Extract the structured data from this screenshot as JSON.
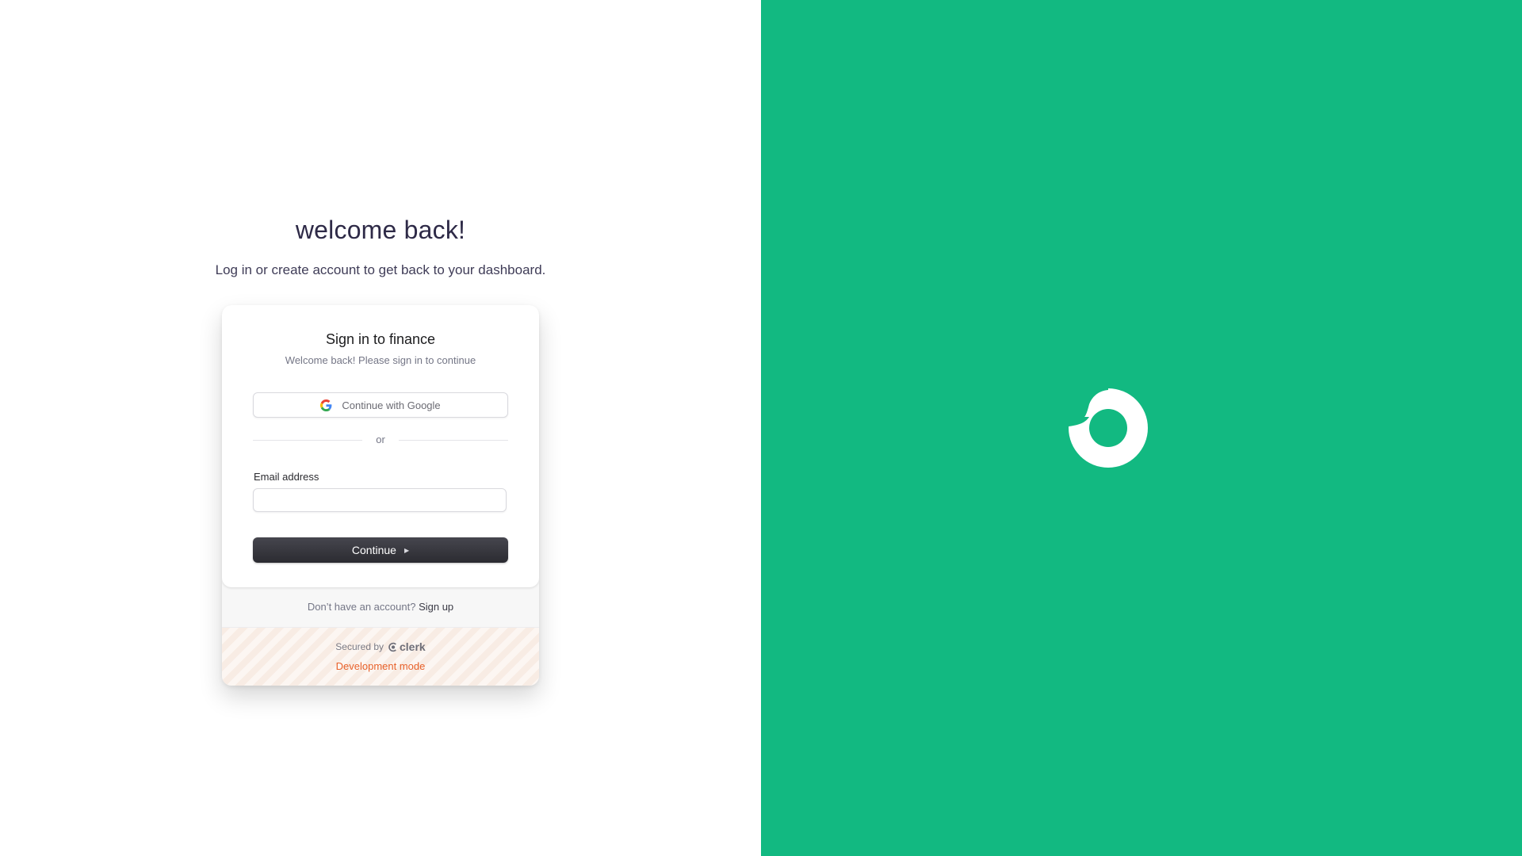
{
  "intro": {
    "heading": "welcome back!",
    "subheading": "Log in or create account to get back to your dashboard."
  },
  "signin_card": {
    "title": "Sign in to finance",
    "subtitle": "Welcome back! Please sign in to continue",
    "google_button_label": "Continue with Google",
    "divider_text": "or",
    "email_label": "Email address",
    "email_value": "",
    "continue_label": "Continue",
    "signup_prompt": "Don’t have an account?",
    "signup_link": "Sign up",
    "secured_by": "Secured by",
    "clerk_brand": "clerk",
    "dev_mode": "Development mode"
  },
  "icons": {
    "google": "google-icon",
    "continue_arrow": "play-arrow-icon",
    "clerk": "clerk-logo-icon",
    "brand": "brand-logo-icon"
  },
  "colors": {
    "brand_green": "#12b981",
    "button_dark": "#2b2b31",
    "dev_mode_orange": "#e8622b",
    "heading_text": "#2e2a47"
  }
}
